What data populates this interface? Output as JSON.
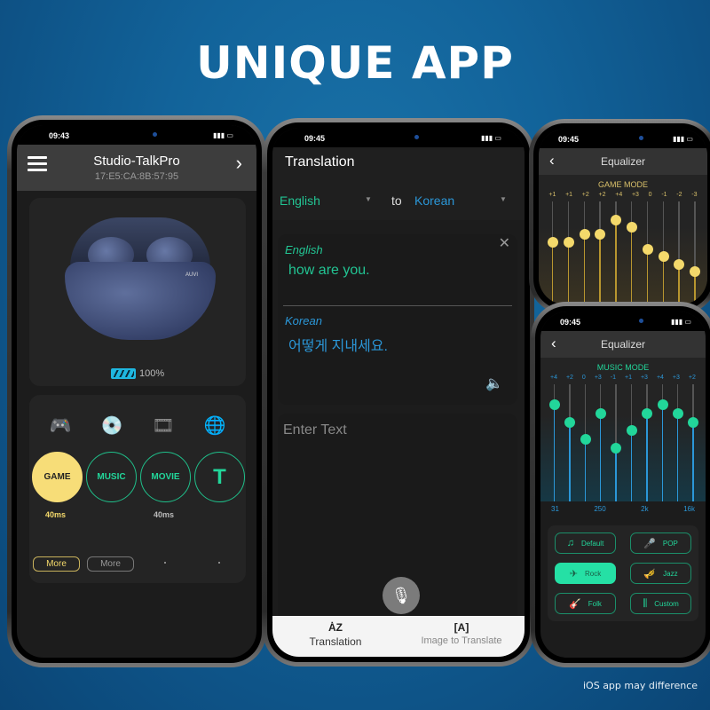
{
  "headline": "UNIQUE APP",
  "footnote": "iOS app may difference",
  "phone_device": {
    "status_time": "09:43",
    "battery": "73",
    "header": {
      "title": "Studio-TalkPro",
      "mac": "17:E5:CA:8B:57:95"
    },
    "earbuds": {
      "brand": "AUVI",
      "battery_percent": "100%"
    },
    "mode_icons": [
      "game-controller-icon",
      "music-disc-icon",
      "movie-film-icon",
      "translate-globe-icon"
    ],
    "modes": [
      {
        "label": "GAME",
        "active": true,
        "latency": "40ms"
      },
      {
        "label": "MUSIC",
        "active": false,
        "latency": ""
      },
      {
        "label": "MOVIE",
        "active": false,
        "latency": "40ms"
      },
      {
        "label": "T",
        "active": false,
        "latency": ""
      }
    ],
    "more_buttons": [
      "More",
      "More"
    ]
  },
  "phone_translation": {
    "status_time": "09:45",
    "battery": "73",
    "title": "Translation",
    "source_lang": "English",
    "to_label": "to",
    "target_lang": "Korean",
    "source_label": "English",
    "source_text": "how are you.",
    "target_label": "Korean",
    "target_text": "어떻게 지내세요.",
    "input_placeholder": "Enter Text",
    "tabs": [
      {
        "label": "Translation",
        "icon": "ȦZ",
        "active": true
      },
      {
        "label": "Image to Translate",
        "icon": "[A]",
        "active": false
      }
    ]
  },
  "eq_game": {
    "status_time": "09:45",
    "title": "Equalizer",
    "mode": "GAME MODE",
    "color": "#f4d96b",
    "values": [
      1,
      1,
      2,
      2,
      4,
      3,
      0,
      -1,
      -2,
      -3
    ],
    "labels": [
      "+1",
      "+1",
      "+2",
      "+2",
      "+4",
      "+3",
      "0",
      "-1",
      "-2",
      "-3"
    ]
  },
  "eq_music": {
    "status_time": "09:45",
    "title": "Equalizer",
    "mode": "MUSIC MODE",
    "color": "#22d69a",
    "values": [
      4,
      2,
      0,
      3,
      -1,
      1,
      3,
      4,
      3,
      2
    ],
    "labels": [
      "+4",
      "+2",
      "0",
      "+3",
      "-1",
      "+1",
      "+3",
      "+4",
      "+3",
      "+2"
    ],
    "freqs": [
      "31",
      "250",
      "2k",
      "16k"
    ],
    "presets": [
      {
        "label": "Default",
        "icon": "♫",
        "active": false
      },
      {
        "label": "POP",
        "icon": "🎤",
        "active": false
      },
      {
        "label": "Rock",
        "icon": "✈",
        "active": true
      },
      {
        "label": "Jazz",
        "icon": "🎺",
        "active": false
      },
      {
        "label": "Folk",
        "icon": "🎸",
        "active": false
      },
      {
        "label": "Custom",
        "icon": "⫼",
        "active": false
      }
    ]
  }
}
